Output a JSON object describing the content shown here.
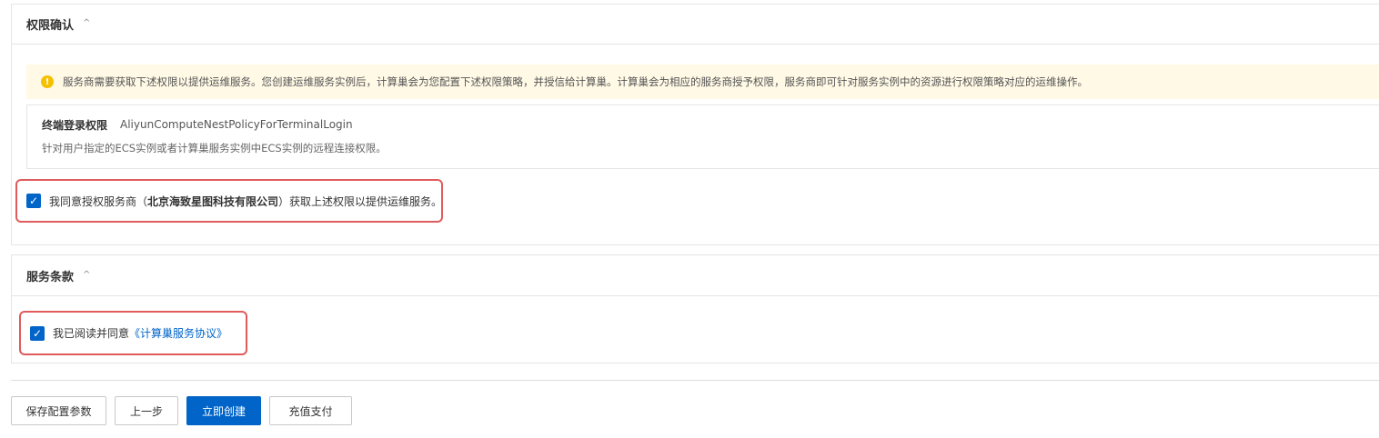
{
  "permission": {
    "title": "权限确认",
    "caret": "^",
    "notice_icon": "!",
    "notice": "服务商需要获取下述权限以提供运维服务。您创建运维服务实例后，计算巢会为您配置下述权限策略，并授信给计算巢。计算巢会为相应的服务商授予权限，服务商即可针对服务实例中的资源进行权限策略对应的运维操作。",
    "policy": {
      "name": "终端登录权限",
      "id": "AliyunComputeNestPolicyForTerminalLogin",
      "description": "针对用户指定的ECS实例或者计算巢服务实例中ECS实例的远程连接权限。"
    },
    "agree": {
      "checked": true,
      "check_mark": "✓",
      "prefix": "我同意授权服务商（",
      "provider": "北京海致星图科技有限公司",
      "suffix": "）获取上述权限以提供运维服务。"
    }
  },
  "terms": {
    "title": "服务条款",
    "caret": "^",
    "agree": {
      "checked": true,
      "check_mark": "✓",
      "prefix": "我已阅读并同意",
      "link": "《计算巢服务协议》"
    }
  },
  "footer": {
    "save_label": "保存配置参数",
    "prev_label": "上一步",
    "create_label": "立即创建",
    "recharge_label": "充值支付"
  },
  "colors": {
    "primary": "#0064c8",
    "highlight_border": "#e05b5b",
    "notice_bg": "#fff9e6",
    "warning": "#f5c000"
  }
}
